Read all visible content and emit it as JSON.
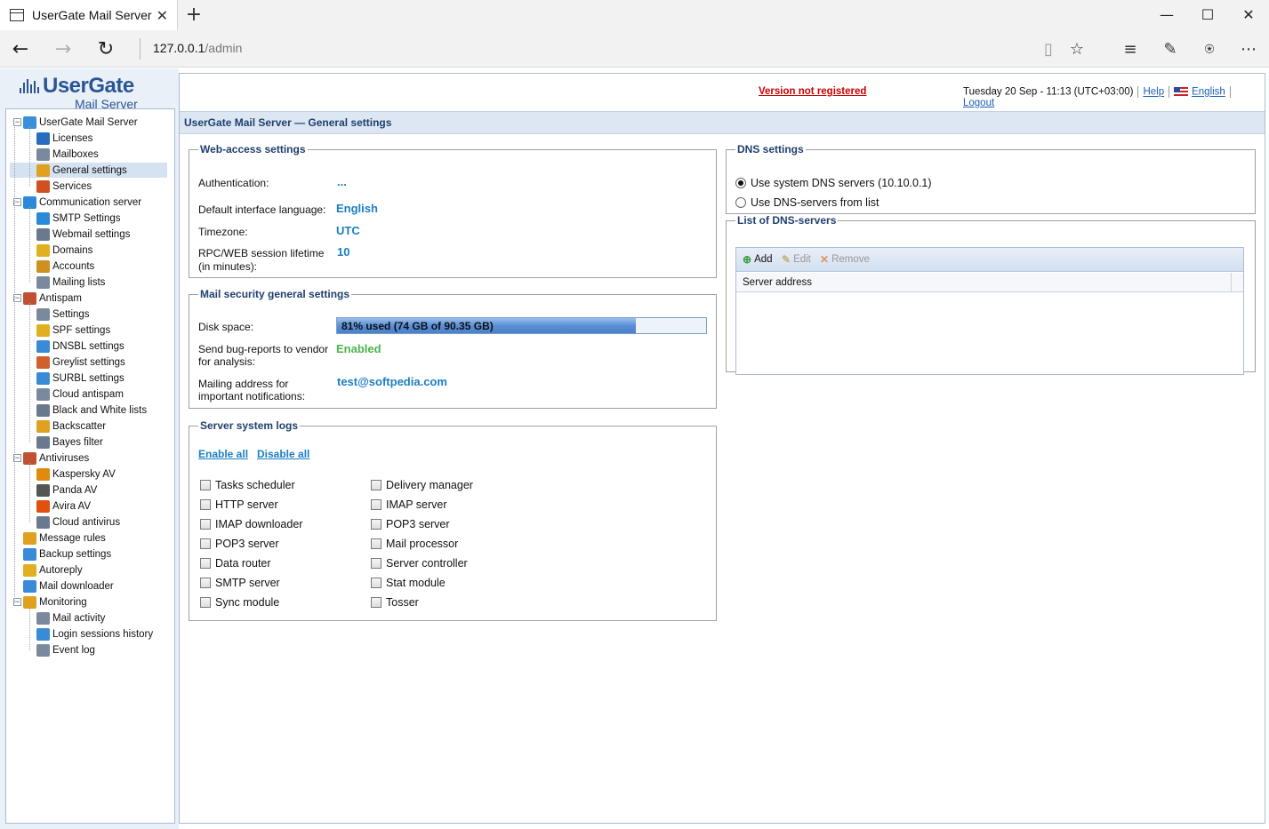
{
  "browser": {
    "tab_title": "UserGate Mail Server",
    "url_host": "127.0.0.1",
    "url_path": "/admin"
  },
  "logo": {
    "main": "UserGate",
    "sub": "Mail Server"
  },
  "tree": [
    {
      "label": "UserGate Mail Server",
      "icon": "usergate-icon",
      "color": "#3a8fd8"
    },
    {
      "label": "Licenses",
      "icon": "licenses-icon",
      "color": "#2a6cc0"
    },
    {
      "label": "Mailboxes",
      "icon": "mailboxes-icon",
      "color": "#7a8a9c"
    },
    {
      "label": "General settings",
      "icon": "general-settings-icon",
      "color": "#e0a020"
    },
    {
      "label": "Services",
      "icon": "services-icon",
      "color": "#d05020"
    },
    {
      "label": "Communication server",
      "icon": "communication-server-icon",
      "color": "#2a8ad8"
    },
    {
      "label": "SMTP Settings",
      "icon": "smtp-icon",
      "color": "#2a8ad8"
    },
    {
      "label": "Webmail settings",
      "icon": "webmail-icon",
      "color": "#6a7a8c"
    },
    {
      "label": "Domains",
      "icon": "domains-icon",
      "color": "#e0b020"
    },
    {
      "label": "Accounts",
      "icon": "accounts-icon",
      "color": "#d09020"
    },
    {
      "label": "Mailing lists",
      "icon": "mailing-lists-icon",
      "color": "#7a8a9c"
    },
    {
      "label": "Antispam",
      "icon": "antispam-icon",
      "color": "#c05030"
    },
    {
      "label": "Settings",
      "icon": "settings-icon",
      "color": "#7a8a9c"
    },
    {
      "label": "SPF settings",
      "icon": "spf-icon",
      "color": "#e0b020"
    },
    {
      "label": "DNSBL settings",
      "icon": "dnsbl-icon",
      "color": "#3a8ad8"
    },
    {
      "label": "Greylist settings",
      "icon": "greylist-icon",
      "color": "#d06030"
    },
    {
      "label": "SURBL settings",
      "icon": "surbl-icon",
      "color": "#3a8ad8"
    },
    {
      "label": "Cloud antispam",
      "icon": "cloud-antispam-icon",
      "color": "#7a8a9c"
    },
    {
      "label": "Black and White lists",
      "icon": "black-white-lists-icon",
      "color": "#6a7a8c"
    },
    {
      "label": "Backscatter",
      "icon": "backscatter-icon",
      "color": "#e0a020"
    },
    {
      "label": "Bayes filter",
      "icon": "bayes-filter-icon",
      "color": "#6a7a8c"
    },
    {
      "label": "Antiviruses",
      "icon": "antiviruses-icon",
      "color": "#c05030"
    },
    {
      "label": "Kaspersky AV",
      "icon": "kaspersky-icon",
      "color": "#e08a10"
    },
    {
      "label": "Panda AV",
      "icon": "panda-icon",
      "color": "#555555"
    },
    {
      "label": "Avira AV",
      "icon": "avira-icon",
      "color": "#e05010"
    },
    {
      "label": "Cloud antivirus",
      "icon": "cloud-antivirus-icon",
      "color": "#6a7a8c"
    },
    {
      "label": "Message rules",
      "icon": "message-rules-icon",
      "color": "#e0a020"
    },
    {
      "label": "Backup settings",
      "icon": "backup-settings-icon",
      "color": "#3a8ad8"
    },
    {
      "label": "Autoreply",
      "icon": "autoreply-icon",
      "color": "#e0b020"
    },
    {
      "label": "Mail downloader",
      "icon": "mail-downloader-icon",
      "color": "#3a8ad8"
    },
    {
      "label": "Monitoring",
      "icon": "monitoring-icon",
      "color": "#e0a020"
    },
    {
      "label": "Mail activity",
      "icon": "mail-activity-icon",
      "color": "#7a8a9c"
    },
    {
      "label": "Login sessions history",
      "icon": "login-sessions-icon",
      "color": "#3a8ad8"
    },
    {
      "label": "Event log",
      "icon": "event-log-icon",
      "color": "#7a8a9c"
    }
  ],
  "top": {
    "not_registered": "Version not registered",
    "datetime": "Tuesday 20 Sep - 11:13 (UTC+03:00)",
    "help": "Help",
    "language": "English",
    "logout": "Logout"
  },
  "page_title": "UserGate Mail Server — General settings",
  "web_access": {
    "legend": "Web-access settings",
    "auth_label": "Authentication:",
    "auth_value": "...",
    "lang_label": "Default interface language:",
    "lang_value": "English",
    "tz_label": "Timezone:",
    "tz_value": "UTC",
    "lifetime_label_1": "RPC/WEB session lifetime",
    "lifetime_label_2": "(in minutes):",
    "lifetime_value": "10"
  },
  "mail_security": {
    "legend": "Mail security general settings",
    "disk_label": "Disk space:",
    "disk_text": "81% used (74 GB of 90.35 GB)",
    "disk_used_fraction": 0.81,
    "bug_label_1": "Send bug-reports to vendor",
    "bug_label_2": "for analysis:",
    "bug_value": "Enabled",
    "mail_label_1": "Mailing address for",
    "mail_label_2": "important notifications:",
    "mail_value": "test@softpedia.com"
  },
  "logs": {
    "legend": "Server system logs",
    "enable_all": "Enable all",
    "disable_all": "Disable all",
    "col1": [
      "Tasks scheduler",
      "HTTP server",
      "IMAP downloader",
      "POP3 server",
      "Data router",
      "SMTP server",
      "Sync module"
    ],
    "col2": [
      "Delivery manager",
      "IMAP server",
      "POP3 server",
      "Mail processor",
      "Server controller",
      "Stat module",
      "Tosser"
    ]
  },
  "dns": {
    "legend": "DNS settings",
    "opt_system": "Use system DNS servers (10.10.0.1)",
    "opt_list": "Use DNS-servers from list",
    "list_legend": "List of DNS-servers",
    "add": "Add",
    "edit": "Edit",
    "remove": "Remove",
    "col_header": "Server address"
  }
}
